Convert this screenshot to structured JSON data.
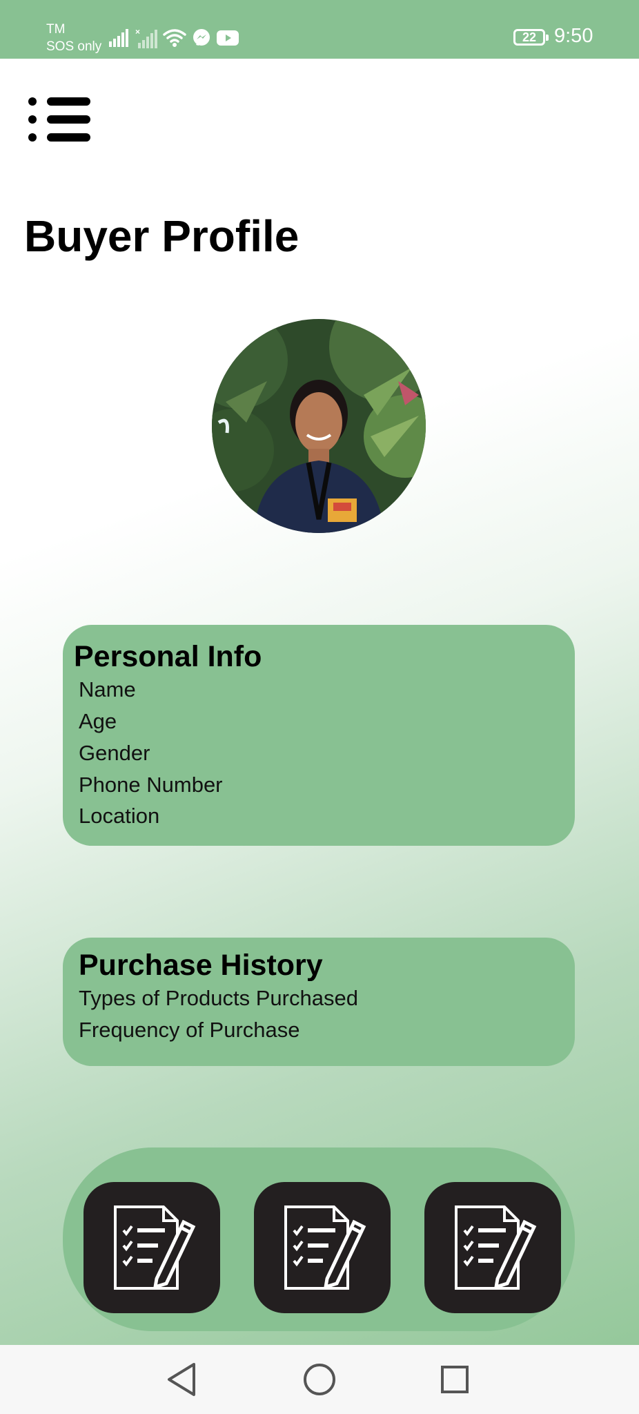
{
  "status_bar": {
    "carrier_line1": "TM",
    "carrier_line2": "SOS only",
    "battery_level": "22",
    "time": "9:50",
    "icons": [
      "signal-bars-icon",
      "signal-no-service-icon",
      "wifi-icon",
      "messenger-icon",
      "youtube-icon",
      "battery-icon"
    ]
  },
  "header": {
    "menu_icon": "menu-list-icon"
  },
  "page": {
    "title": "Buyer Profile"
  },
  "profile": {
    "avatar": "profile-photo"
  },
  "personal_info": {
    "title": "Personal Info",
    "fields": [
      "Name",
      "Age",
      "Gender",
      "Phone Number",
      "Location"
    ]
  },
  "purchase_history": {
    "title": "Purchase History",
    "fields": [
      "Types of Products Purchased",
      "Frequency of Purchase"
    ]
  },
  "actions": {
    "buttons": [
      {
        "icon": "edit-document-icon"
      },
      {
        "icon": "edit-document-icon"
      },
      {
        "icon": "edit-document-icon"
      }
    ]
  },
  "nav_bar": {
    "icons": [
      "back-icon",
      "home-icon",
      "recents-icon"
    ]
  },
  "colors": {
    "accent_green": "#88c192",
    "action_button": "#231f20",
    "nav_background": "#f7f7f7"
  }
}
